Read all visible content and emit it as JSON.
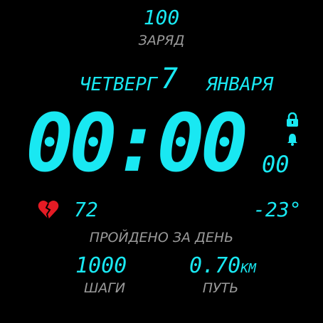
{
  "colors": {
    "accent": "#19e8f2",
    "muted": "#9a9a9a",
    "heart": "#e51b24"
  },
  "battery": {
    "value": "100",
    "label": "ЗАРЯД"
  },
  "date": {
    "weekday": "ЧЕТВЕРГ",
    "day": "7",
    "month": "ЯНВАРЯ"
  },
  "time": {
    "hhmm": "00:00",
    "seconds": "00"
  },
  "status_icons": [
    "lock-icon",
    "bell-icon"
  ],
  "heart_rate": {
    "value": "72",
    "icon": "broken-heart-icon"
  },
  "weather": {
    "temperature": "-23°"
  },
  "daily": {
    "label": "ПРОЙДЕНО ЗА ДЕНЬ",
    "steps": {
      "value": "1000",
      "label": "ШАГИ"
    },
    "distance": {
      "value": "0.70",
      "unit": "KM",
      "label": "ПУТЬ"
    }
  }
}
